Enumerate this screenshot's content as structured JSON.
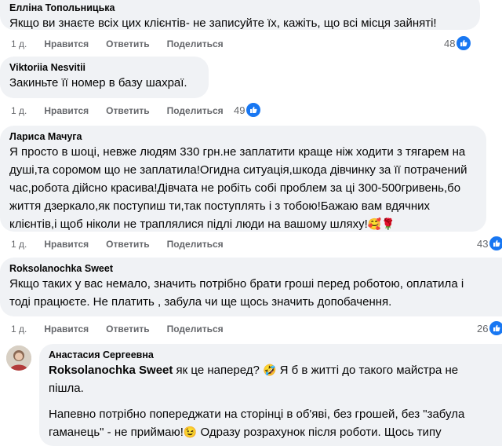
{
  "actions": {
    "like": "Нравится",
    "reply": "Ответить",
    "share": "Поделиться"
  },
  "comments": [
    {
      "author": "Елліна Топольницька",
      "lines": [
        "Якщо ви знаєте всіх цих клієнтів- не записуйте їх, кажіть, що всі місця зайняті!"
      ],
      "age": "1 д.",
      "likes": "48"
    },
    {
      "author": "Viktoriia Nesvitii",
      "lines": [
        "Закиньте її номер в базу шахраї."
      ],
      "age": "1 д.",
      "likes": "49"
    },
    {
      "author": "Лариса Мачуга",
      "lines": [
        "Я просто в шоці, невже людям 330 грн.не заплатити краще ніж ходити з тягарем на",
        "душі,та соромом що не заплатила!Огидна ситуація,шкода дівчинку за її потрачений",
        "час,робота дійсно красива!Дівчата не робіть собі проблем за ці 300-500гривень,бо",
        "життя дзеркало,як поступиш ти,так поступлять і з тобою!Бажаю вам вдячних",
        "клієнтів,і щоб ніколи не траплялися підлі люди на вашому шляху!"
      ],
      "emoji_end": "🥰🌹",
      "age": "1 д.",
      "likes": "43"
    },
    {
      "author": "Roksolanochka Sweet",
      "lines": [
        "Якщо таких у вас немало, значить потрібно брати гроші перед роботою, оплатила і",
        "тоді працюєте. Не платить , забула чи ще щось значить допобачення."
      ],
      "age": "1 д.",
      "likes": "26"
    }
  ],
  "reply": {
    "author": "Анастасия Сергеевна",
    "mention": "Roksolanochka Sweet",
    "line1_after": " як це наперед? ",
    "emoji1": "🤣",
    "line1_end": " Я б в житті до такого майстра не",
    "line2": "пішла.",
    "para2_line1": "Напевно потрібно попереджати на сторінці в об'яві, без грошей, без \"забула",
    "para2_line2_a": "гаманець\" - не приймаю!",
    "emoji2": "😉",
    "para2_line2_b": " Одразу розрахунок після роботи. Щось типу"
  }
}
